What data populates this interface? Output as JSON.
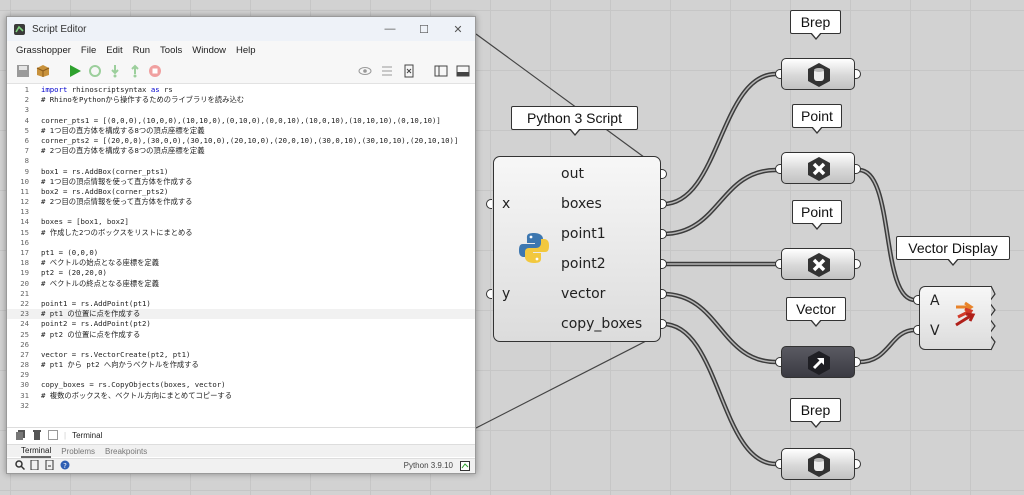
{
  "editor": {
    "window_title": "Script Editor",
    "window_buttons": [
      "—",
      "☐",
      "✕"
    ],
    "menu": [
      "Grasshopper",
      "File",
      "Edit",
      "Run",
      "Tools",
      "Window",
      "Help"
    ],
    "code_lines": [
      {
        "n": "1",
        "t": "import rhinoscriptsyntax as rs"
      },
      {
        "n": "2",
        "t": "# RhinoをPythonから操作するためのライブラリを読み込む"
      },
      {
        "n": "3",
        "t": ""
      },
      {
        "n": "4",
        "t": "corner_pts1 = [(0,0,0),(10,0,0),(10,10,0),(0,10,0),(0,0,10),(10,0,10),(10,10,10),(0,10,10)]"
      },
      {
        "n": "5",
        "t": "# 1つ目の直方体を構成する8つの頂点座標を定義"
      },
      {
        "n": "6",
        "t": "corner_pts2 = [(20,0,0),(30,0,0),(30,10,0),(20,10,0),(20,0,10),(30,0,10),(30,10,10),(20,10,10)]"
      },
      {
        "n": "7",
        "t": "# 2つ目の直方体を構成する8つの頂点座標を定義"
      },
      {
        "n": "8",
        "t": ""
      },
      {
        "n": "9",
        "t": "box1 = rs.AddBox(corner_pts1)"
      },
      {
        "n": "10",
        "t": "# 1つ目の頂点情報を使って直方体を作成する"
      },
      {
        "n": "11",
        "t": "box2 = rs.AddBox(corner_pts2)"
      },
      {
        "n": "12",
        "t": "# 2つ目の頂点情報を使って直方体を作成する"
      },
      {
        "n": "13",
        "t": ""
      },
      {
        "n": "14",
        "t": "boxes = [box1, box2]"
      },
      {
        "n": "15",
        "t": "# 作成した2つのボックスをリストにまとめる"
      },
      {
        "n": "16",
        "t": ""
      },
      {
        "n": "17",
        "t": "pt1 = (0,0,0)"
      },
      {
        "n": "18",
        "t": "# ベクトルの始点となる座標を定義"
      },
      {
        "n": "19",
        "t": "pt2 = (20,20,0)"
      },
      {
        "n": "20",
        "t": "# ベクトルの終点となる座標を定義"
      },
      {
        "n": "21",
        "t": ""
      },
      {
        "n": "22",
        "t": "point1 = rs.AddPoint(pt1)"
      },
      {
        "n": "23",
        "t": "# pt1 の位置に点を作成する"
      },
      {
        "n": "24",
        "t": "point2 = rs.AddPoint(pt2)"
      },
      {
        "n": "25",
        "t": "# pt2 の位置に点を作成する"
      },
      {
        "n": "26",
        "t": ""
      },
      {
        "n": "27",
        "t": "vector = rs.VectorCreate(pt2, pt1)"
      },
      {
        "n": "28",
        "t": "# pt1 から pt2 へ向かうベクトルを作成する"
      },
      {
        "n": "29",
        "t": ""
      },
      {
        "n": "30",
        "t": "copy_boxes = rs.CopyObjects(boxes, vector)"
      },
      {
        "n": "31",
        "t": "# 複数のボックスを、ベクトル方向にまとめてコピーする"
      },
      {
        "n": "32",
        "t": ""
      }
    ],
    "terminal_label": "Terminal",
    "tabs": [
      "Terminal",
      "Problems",
      "Breakpoints"
    ],
    "python_version": "Python 3.9.10"
  },
  "canvas": {
    "python_component": {
      "label": "Python 3 Script",
      "inputs": [
        "x",
        "y"
      ],
      "outputs": [
        "out",
        "boxes",
        "point1",
        "point2",
        "vector",
        "copy_boxes"
      ]
    },
    "params": {
      "brep_top": "Brep",
      "point_1": "Point",
      "point_2": "Point",
      "vector": "Vector",
      "brep_bottom": "Brep"
    },
    "vector_display": {
      "label": "Vector Display",
      "inputs": [
        "A",
        "V"
      ]
    }
  },
  "colors": {
    "wire": "#3c3c3c",
    "wire_light": "#9a9a9a",
    "run_green": "#2ea12e",
    "code_comment": "#008000",
    "code_keyword": "#0000cc"
  }
}
